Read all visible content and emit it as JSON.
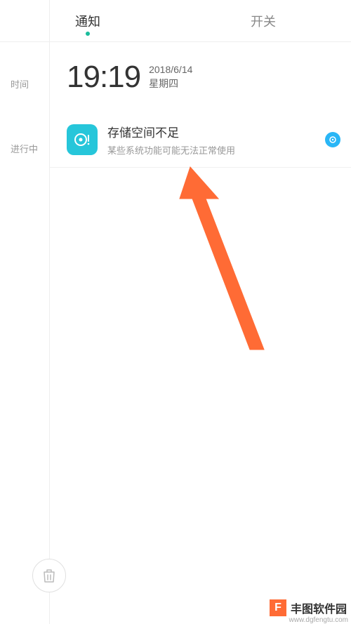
{
  "tabs": {
    "notifications": "通知",
    "switches": "开关"
  },
  "timeline": {
    "time_label": "时间",
    "time": "19:19",
    "date": "2018/6/14",
    "weekday": "星期四"
  },
  "ongoing": {
    "label": "进行中",
    "notification": {
      "title": "存储空间不足",
      "description": "某些系统功能可能无法正常使用"
    }
  },
  "watermark": {
    "logo_letter": "F",
    "name": "丰图软件园",
    "url": "www.dgfengtu.com"
  },
  "colors": {
    "accent": "#1abc9c",
    "icon_bg": "#26c6da",
    "badge": "#29b6f6",
    "arrow": "#ff6b35"
  }
}
